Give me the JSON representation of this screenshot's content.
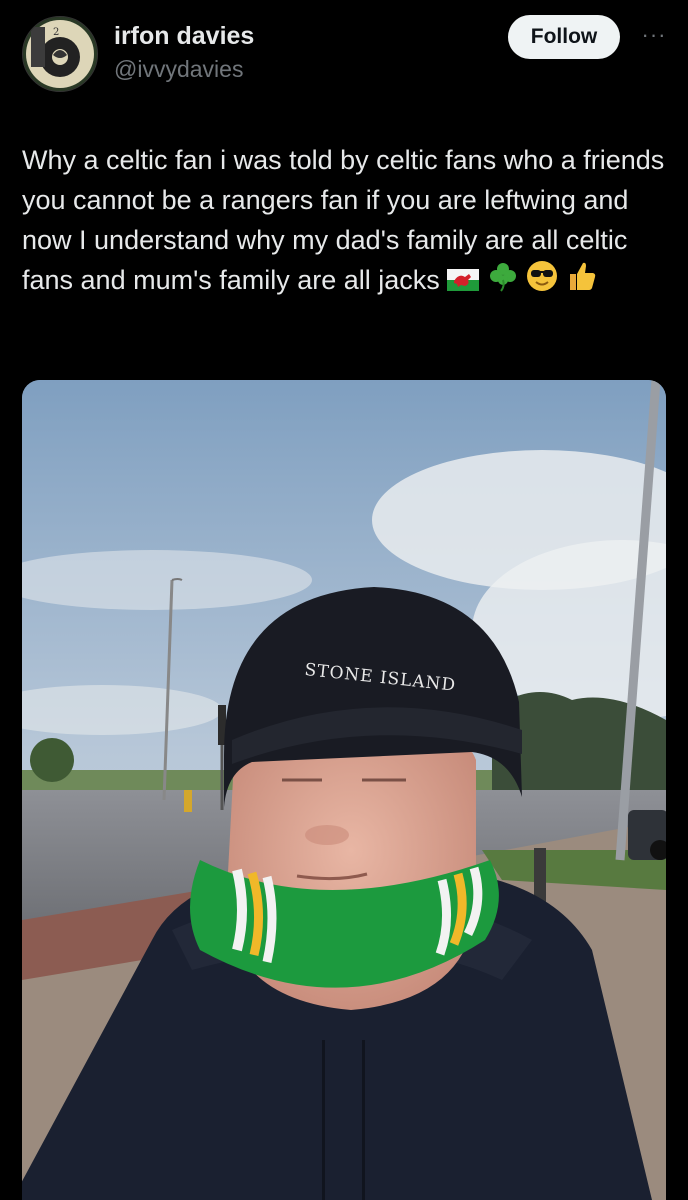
{
  "author": {
    "name": "irfon davies",
    "handle": "@ivvydavies"
  },
  "actions": {
    "follow_label": "Follow",
    "more_label": "···"
  },
  "tweet": {
    "text": "Why a celtic fan i was told by celtic fans who a friends you cannot be a rangers fan if you are leftwing and now I understand why my dad's family are all celtic fans and mum's family are all jacks",
    "emojis": [
      "welsh-flag-icon",
      "shamrock-icon",
      "sunglasses-face-icon",
      "thumbs-up-icon"
    ]
  },
  "media": {
    "hat_text": "STONE ISLAND"
  }
}
